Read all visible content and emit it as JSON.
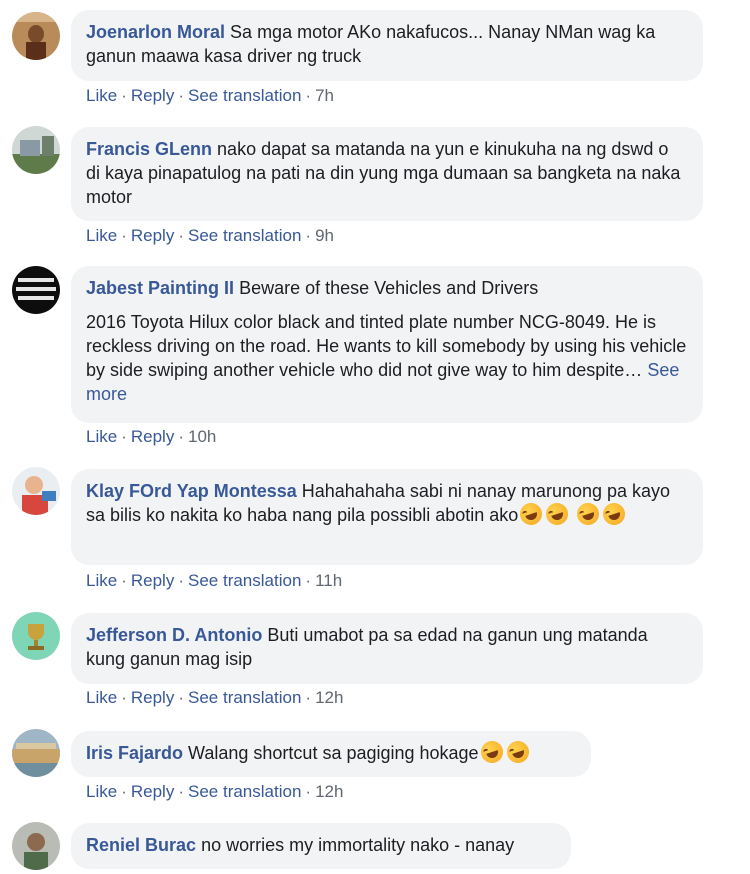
{
  "actions": {
    "like": "Like",
    "reply": "Reply",
    "see_translation": "See translation",
    "separator": "·"
  },
  "comments": [
    {
      "author": "Joenarlon Moral",
      "text": "Sa mga motor AKo nakafucos... Nanay NMan wag ka ganun maawa kasa driver ng truck",
      "time": "7h",
      "avatar_icon": "man-outdoor-avatar"
    },
    {
      "author": "Francis GLenn",
      "text": "nako dapat sa matanda na yun e kinukuha na ng dswd o di kaya pinapatulog na pati na din yung mga dumaan sa bangketa na naka motor",
      "time": "9h",
      "avatar_icon": "street-photo-avatar"
    },
    {
      "author": "Jabest Painting II",
      "text": "Beware of these Vehicles and Drivers",
      "text2": "2016 Toyota Hilux color black and tinted plate number NCG-8049. He is reckless driving on the road. He wants to kill somebody by using his vehicle by side swiping another vehicle who did not give way to him despite…",
      "see_more": "See more",
      "time": "10h",
      "avatar_icon": "text-logo-avatar"
    },
    {
      "author": "Klay FOrd Yap Montessa",
      "text": "Hahahahaha sabi ni nanay marunong pa kayo sa bilis ko nakita ko haba nang pila possibli abotin ako",
      "emoji": "laughing-emoji",
      "time": "11h",
      "avatar_icon": "child-avatar"
    },
    {
      "author": "Jefferson D. Antonio",
      "text": "Buti umabot pa sa edad na ganun ung matanda kung ganun mag isip",
      "time": "12h",
      "avatar_icon": "trophy-avatar"
    },
    {
      "author": "Iris Fajardo",
      "text": "Walang shortcut sa pagiging hokage",
      "emoji": "laughing-emoji",
      "time": "12h",
      "avatar_icon": "landscape-avatar"
    },
    {
      "author": "Reniel Burac",
      "text": "no worries my immortality nako - nanay",
      "avatar_icon": "person-avatar"
    }
  ]
}
